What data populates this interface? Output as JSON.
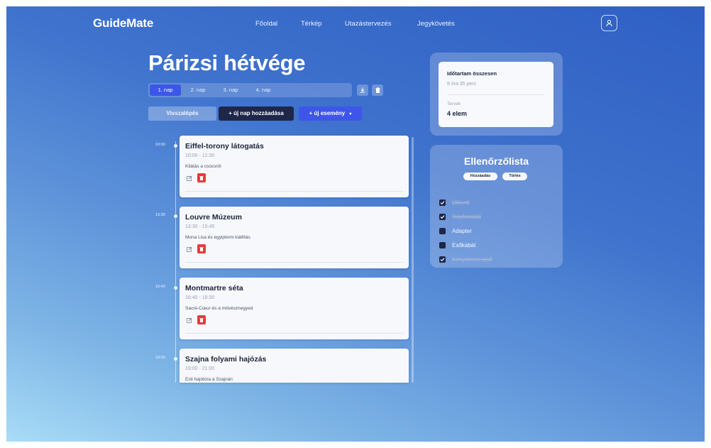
{
  "header": {
    "logo": "GuideMate",
    "nav": [
      "Főoldal",
      "Térkép",
      "Utazástervezés",
      "Jegykövetés"
    ]
  },
  "trip": {
    "title": "Párizsi hétvége",
    "days": [
      "1. nap",
      "2. nap",
      "3. nap",
      "4. nap"
    ],
    "active_day": "1. nap",
    "buttons": {
      "back": "Visszalépés",
      "add_day": "+ új nap hozzáadása",
      "add_event": "+ új esemény"
    }
  },
  "events": [
    {
      "time": "10:00",
      "title": "Eiffel-torony látogatás",
      "range": "10:00 - 12:30",
      "desc": "Kilátás a csúcsról"
    },
    {
      "time": "13:30",
      "title": "Louvre Múzeum",
      "range": "13:30 - 15:45",
      "desc": "Mona Lisa és egyiptomi kiállítás"
    },
    {
      "time": "16:40",
      "title": "Montmartre séta",
      "range": "16:40 - 18:30",
      "desc": "Sacré-Cœur és a művésznegyed"
    },
    {
      "time": "19:00",
      "title": "Szajna folyami hajózás",
      "range": "19:00 - 21:00",
      "desc": "Esti hajótúra a Szajnán"
    }
  ],
  "summary": {
    "duration_label": "Időtartam összesen",
    "duration_value": "8 óra 35 perc",
    "plans_label": "Tervek",
    "plans_value": "4 elem"
  },
  "checklist": {
    "title": "Ellenőrzőlista",
    "add_label": "Hozzáadás",
    "delete_label": "Törlés",
    "items": [
      {
        "label": "Útlevél",
        "checked": true
      },
      {
        "label": "Telefontöltő",
        "checked": true
      },
      {
        "label": "Adapter",
        "checked": false
      },
      {
        "label": "Esőkabát",
        "checked": false
      },
      {
        "label": "Kényelmes cipő",
        "checked": true
      }
    ]
  },
  "colors": {
    "accent": "#3b57e8",
    "dark_button": "#1e2749",
    "delete": "#e43c3c"
  }
}
